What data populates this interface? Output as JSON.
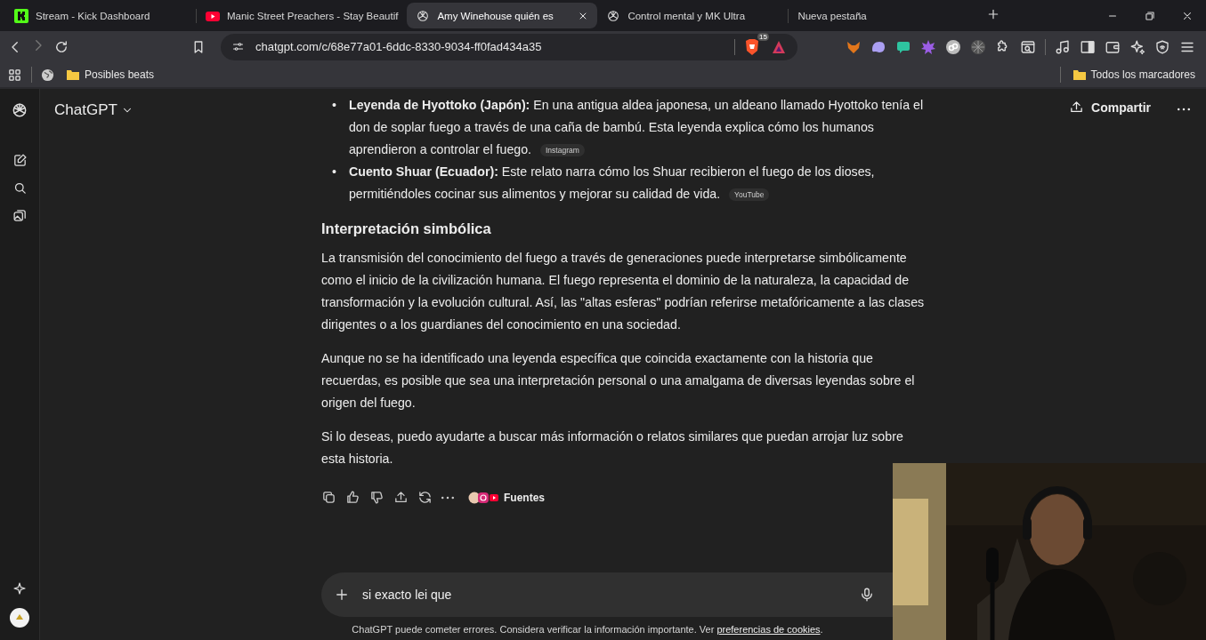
{
  "browser": {
    "tabs": [
      {
        "title": "Stream - Kick Dashboard",
        "selected": false
      },
      {
        "title": "Manic Street Preachers - Stay Beautif",
        "selected": false
      },
      {
        "title": "Amy Winehouse quién es",
        "selected": true
      },
      {
        "title": "Control mental y MK Ultra",
        "selected": false
      },
      {
        "title": "Nueva pestaña",
        "selected": false
      }
    ],
    "address": "chatgpt.com/c/68e77a01-6ddc-8330-9034-ff0fad434a35",
    "shield_count": "15",
    "bookmarks": [
      {
        "label": "Posibles beats"
      }
    ],
    "all_bookmarks": "Todos los marcadores"
  },
  "app": {
    "title": "ChatGPT",
    "share": "Compartir"
  },
  "message": {
    "bullets": [
      {
        "marker": "•",
        "text": "**Leyenda de Hyottoko (Japón):** En una antigua aldea japonesa, un aldeano llamado Hyottoko tenía el don de soplar fuego a través de una caña de bambú. Esta leyenda explica cómo los humanos aprendieron a controlar el fuego.",
        "source": "Instagram"
      },
      {
        "marker": "•",
        "text": "**Cuento Shuar (Ecuador):** Este relato narra cómo los Shuar recibieron el fuego de los dioses, permitiéndoles cocinar sus alimentos y mejorar su calidad de vida.",
        "source": "YouTube"
      }
    ],
    "heading": "Interpretación simbólica",
    "paragraphs": [
      "La transmisión del conocimiento del fuego a través de generaciones puede interpretarse simbólicamente como el inicio de la civilización humana. El fuego representa el dominio de la naturaleza, la capacidad de transformación y la evolución cultural. Así, las \"altas esferas\" podrían referirse metafóricamente a las clases dirigentes o a los guardianes del conocimiento en una sociedad.",
      "Aunque no se ha identificado una leyenda específica que coincida exactamente con la historia que recuerdas, es posible que sea una interpretación personal o una amalgama de diversas leyendas sobre el origen del fuego.",
      "Si lo deseas, puedo ayudarte a buscar más información o relatos similares que puedan arrojar luz sobre esta historia."
    ],
    "sources_label": "Fuentes"
  },
  "composer": {
    "value": "si exacto lei que"
  },
  "footer": {
    "text": "ChatGPT puede cometer errores. Considera verificar la información importante. Ver",
    "link": "preferencias de cookies",
    "suffix": "."
  }
}
